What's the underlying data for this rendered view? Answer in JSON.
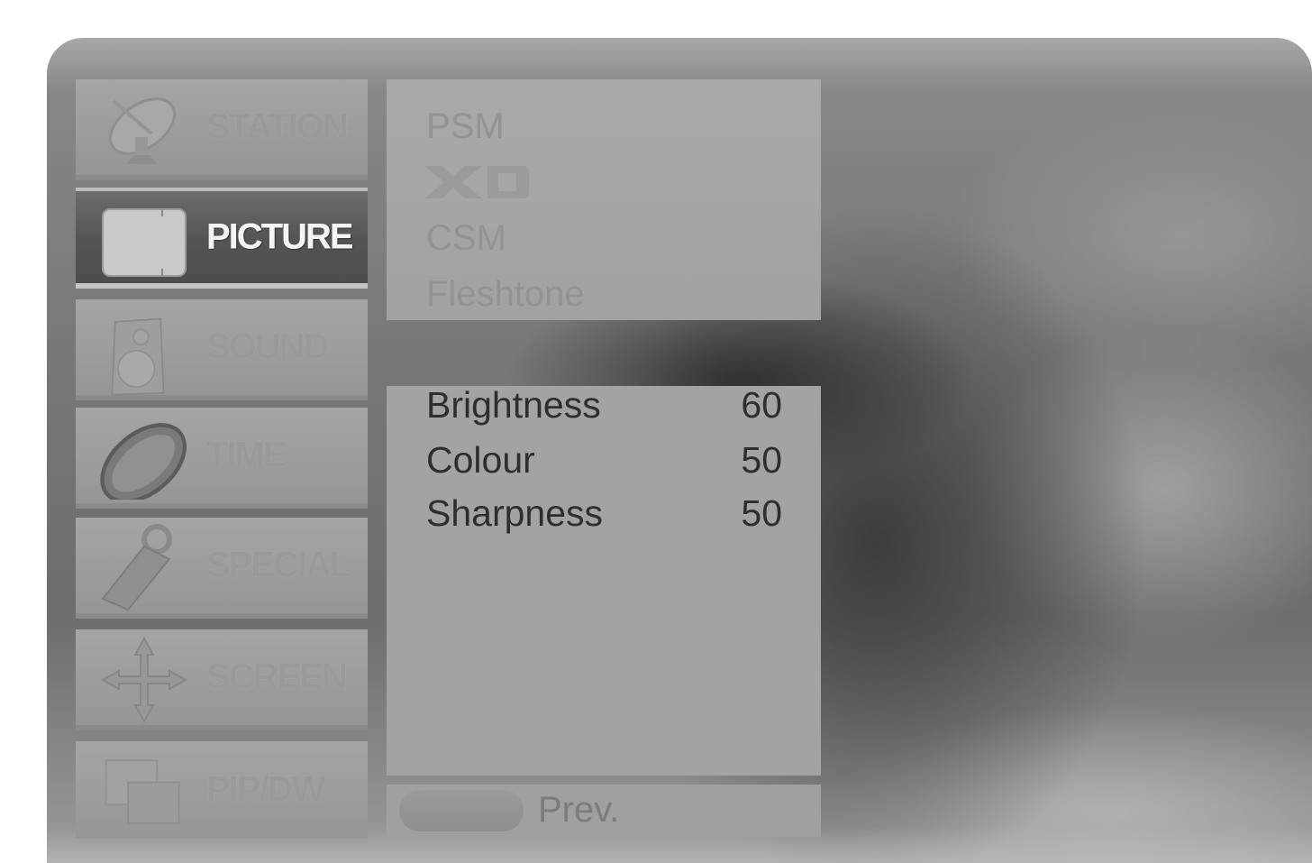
{
  "menu": {
    "items": [
      {
        "label": "STATION",
        "icon": "satellite-dish-icon",
        "selected": false
      },
      {
        "label": "PICTURE",
        "icon": "picture-icon",
        "selected": true
      },
      {
        "label": "SOUND",
        "icon": "speaker-icon",
        "selected": false
      },
      {
        "label": "TIME",
        "icon": "clock-icon",
        "selected": false
      },
      {
        "label": "SPECIAL",
        "icon": "tag-icon",
        "selected": false
      },
      {
        "label": "SCREEN",
        "icon": "move-arrows-icon",
        "selected": false
      },
      {
        "label": "PIP/DW",
        "icon": "pip-icon",
        "selected": false
      }
    ]
  },
  "picture_panel": {
    "options": {
      "psm": "PSM",
      "xd": "XD",
      "csm": "CSM",
      "fleshtone": "Fleshtone"
    },
    "settings": [
      {
        "label": "Brightness",
        "value": "60"
      },
      {
        "label": "Colour",
        "value": "50"
      },
      {
        "label": "Sharpness",
        "value": "50"
      }
    ]
  },
  "footer": {
    "prev_label": "Prev."
  },
  "colors": {
    "selected_menu_bg": "#555555",
    "selected_menu_text": "#f4f4f4",
    "panel_bg": "#a3a3a3",
    "setting_text": "#2e2e2e",
    "dimmed_text": "#939393"
  }
}
